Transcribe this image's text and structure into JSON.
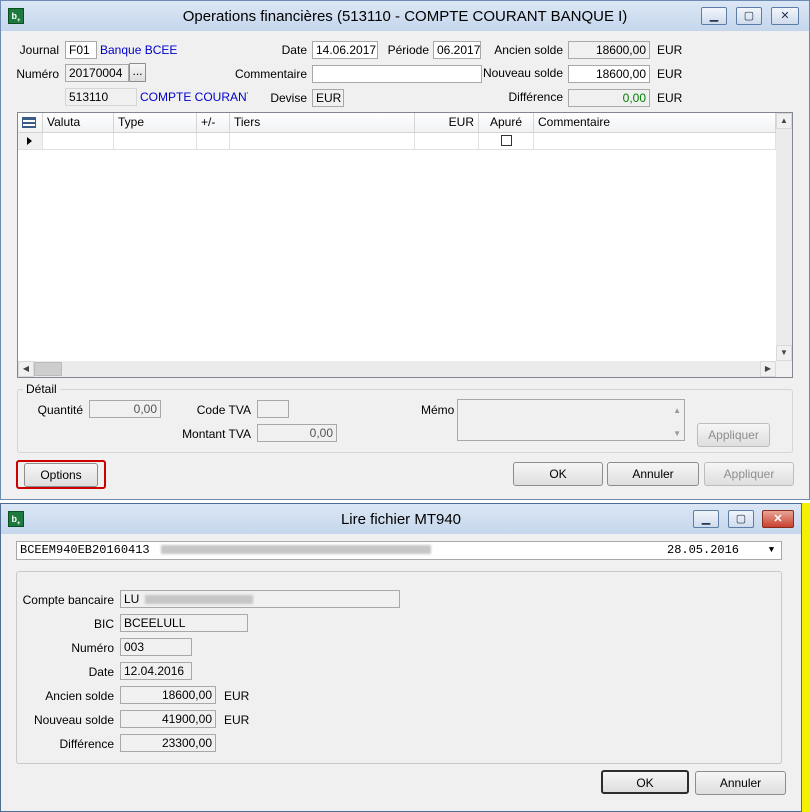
{
  "window1": {
    "title": "Operations financières (513110 - COMPTE COURANT BANQUE I)",
    "journal_label": "Journal",
    "journal_code": "F01",
    "journal_name": "Banque BCEE",
    "numero_label": "Numéro",
    "numero_value": "20170004",
    "numero_button": "...",
    "account_code": "513110",
    "account_name": "COMPTE COURANT E",
    "date_label": "Date",
    "date_value": "14.06.2017",
    "periode_label": "Période",
    "periode_value": "06.2017",
    "commentaire_label": "Commentaire",
    "commentaire_value": "",
    "devise_label": "Devise",
    "devise_value": "EUR",
    "ancien_solde_label": "Ancien solde",
    "ancien_solde_value": "18600,00",
    "nouveau_solde_label": "Nouveau solde",
    "nouveau_solde_value": "18600,00",
    "difference_label": "Différence",
    "difference_value": "0,00",
    "currency": "EUR",
    "grid_columns": [
      "Valuta",
      "Type",
      "+/-",
      "Tiers",
      "EUR",
      "Apuré",
      "Commentaire"
    ],
    "detail_label": "Détail",
    "quantite_label": "Quantité",
    "quantite_value": "0,00",
    "code_tva_label": "Code TVA",
    "code_tva_value": "",
    "montant_tva_label": "Montant TVA",
    "montant_tva_value": "0,00",
    "memo_label": "Mémo",
    "appliquer_detail": "Appliquer",
    "options_button": "Options",
    "ok_button": "OK",
    "annuler_button": "Annuler",
    "appliquer_button": "Appliquer"
  },
  "window2": {
    "title": "Lire fichier MT940",
    "file_name": "BCEEM940EB20160413",
    "file_date": "28.05.2016",
    "compte_label": "Compte bancaire",
    "compte_value": "LU",
    "bic_label": "BIC",
    "bic_value": "BCEELULL",
    "numero_label": "Numéro",
    "numero_value": "003",
    "date_label": "Date",
    "date_value": "12.04.2016",
    "ancien_solde_label": "Ancien solde",
    "ancien_solde_value": "18600,00",
    "nouveau_solde_label": "Nouveau solde",
    "nouveau_solde_value": "41900,00",
    "difference_label": "Différence",
    "difference_value": "23300,00",
    "currency": "EUR",
    "ok_button": "OK",
    "annuler_button": "Annuler"
  },
  "colors": {
    "accent_link": "#0000cc",
    "positive": "#008000",
    "highlight_border": "#cc0000"
  },
  "icons": [
    "app-icon",
    "minimize-icon",
    "maximize-icon",
    "close-icon",
    "row-pointer-icon",
    "scroll-up-icon",
    "scroll-down-icon",
    "scroll-left-icon",
    "scroll-right-icon",
    "dropdown-arrow-icon"
  ]
}
